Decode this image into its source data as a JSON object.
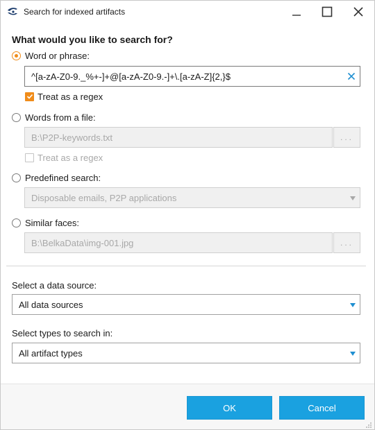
{
  "window": {
    "title": "Search for indexed artifacts",
    "icons": {
      "app": "belkasoft-app-icon",
      "minimize": "minimize-icon",
      "maximize": "maximize-icon",
      "close": "close-icon"
    }
  },
  "heading": "What would you like to search for?",
  "options": {
    "word": {
      "label": "Word or phrase:",
      "selected": true,
      "value": "^[a-zA-Z0-9._%+-]+@[a-zA-Z0-9.-]+\\.[a-zA-Z]{2,}$",
      "regex_label": "Treat as a regex",
      "regex_checked": true
    },
    "file": {
      "label": "Words from a file:",
      "selected": false,
      "value": "B:\\P2P-keywords.txt",
      "browse_label": "...",
      "regex_label": "Treat as a regex",
      "regex_checked": false
    },
    "predefined": {
      "label": "Predefined search:",
      "selected": false,
      "value": "Disposable emails, P2P applications"
    },
    "faces": {
      "label": "Similar faces:",
      "selected": false,
      "value": "B:\\BelkaData\\img-001.jpg",
      "browse_label": "..."
    }
  },
  "data_source": {
    "label": "Select a data source:",
    "value": "All data sources"
  },
  "types": {
    "label": "Select types to search in:",
    "value": "All artifact types"
  },
  "buttons": {
    "ok": "OK",
    "cancel": "Cancel"
  },
  "colors": {
    "accent": "#f08c1a",
    "button": "#1aa1e0",
    "dropdown_arrow": "#1f8fd1"
  }
}
